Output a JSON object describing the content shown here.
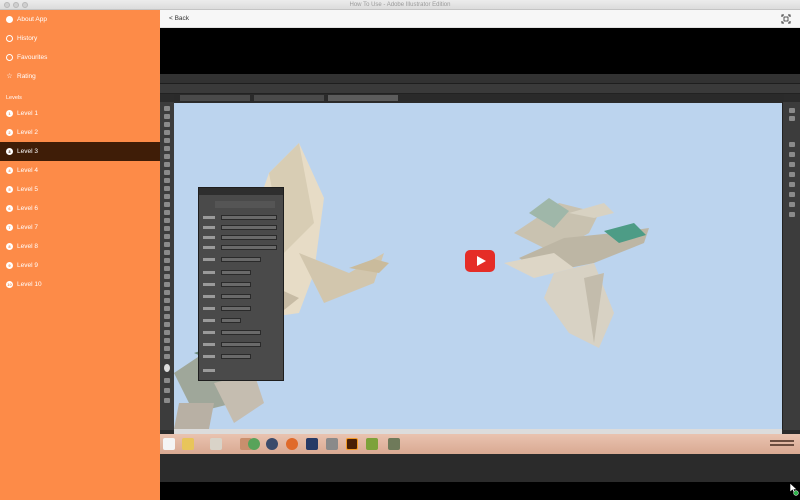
{
  "window": {
    "title": "How To Use - Adobe Illustrator Edition"
  },
  "sidebar": {
    "top_items": [
      {
        "label": "About App",
        "icon": "info-icon"
      },
      {
        "label": "History",
        "icon": "clock-icon"
      },
      {
        "label": "Favourites",
        "icon": "heart-icon"
      },
      {
        "label": "Rating",
        "icon": "star-icon"
      }
    ],
    "section_label": "Levels",
    "levels": [
      {
        "label": "Level 1",
        "badge": "1"
      },
      {
        "label": "Level 2",
        "badge": "2"
      },
      {
        "label": "Level 3",
        "badge": "3",
        "active": true
      },
      {
        "label": "Level 4",
        "badge": "4"
      },
      {
        "label": "Level 5",
        "badge": "5"
      },
      {
        "label": "Level 6",
        "badge": "6"
      },
      {
        "label": "Level 7",
        "badge": "7"
      },
      {
        "label": "Level 8",
        "badge": "8"
      },
      {
        "label": "Level 9",
        "badge": "9"
      },
      {
        "label": "Level 10",
        "badge": "10"
      }
    ]
  },
  "topbar": {
    "back_label": "< Back"
  },
  "video": {
    "play_icon": "youtube-play-icon"
  },
  "colors": {
    "sidebar_bg": "#fd8b48",
    "sidebar_active": "#3f1d07",
    "play_red": "#e52d27",
    "canvas_sky": "#bcd4ee"
  }
}
